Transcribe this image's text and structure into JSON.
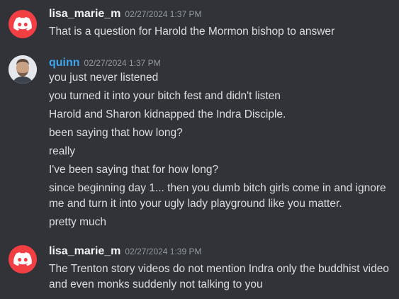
{
  "groups": [
    {
      "username": "lisa_marie_m",
      "timestamp": "02/27/2024 1:37 PM",
      "avatar": "discord-logo-icon",
      "avatar_color": "#f23f43",
      "messages": [
        "That is a question for Harold the Mormon bishop to answer"
      ]
    },
    {
      "username": "quinn",
      "username_color": "#3ba5ee",
      "timestamp": "02/27/2024 1:37 PM",
      "avatar": "user-photo-avatar",
      "messages": [
        "you just never listened",
        "you turned it into your bitch fest and didn't listen",
        "Harold and Sharon kidnapped the Indra Disciple.",
        "been saying that how long?",
        "really",
        "I've been saying that for how long?",
        "since beginning day 1... then you dumb bitch girls come in and ignore",
        "me and turn it into your ugly lady playground like you matter.",
        "pretty much"
      ]
    },
    {
      "username": "lisa_marie_m",
      "timestamp": "02/27/2024 1:39 PM",
      "avatar": "discord-logo-icon",
      "avatar_color": "#f23f43",
      "messages": [
        "The Trenton story videos do not mention Indra only the buddhist video",
        "and even monks suddenly not talking to you"
      ]
    }
  ]
}
